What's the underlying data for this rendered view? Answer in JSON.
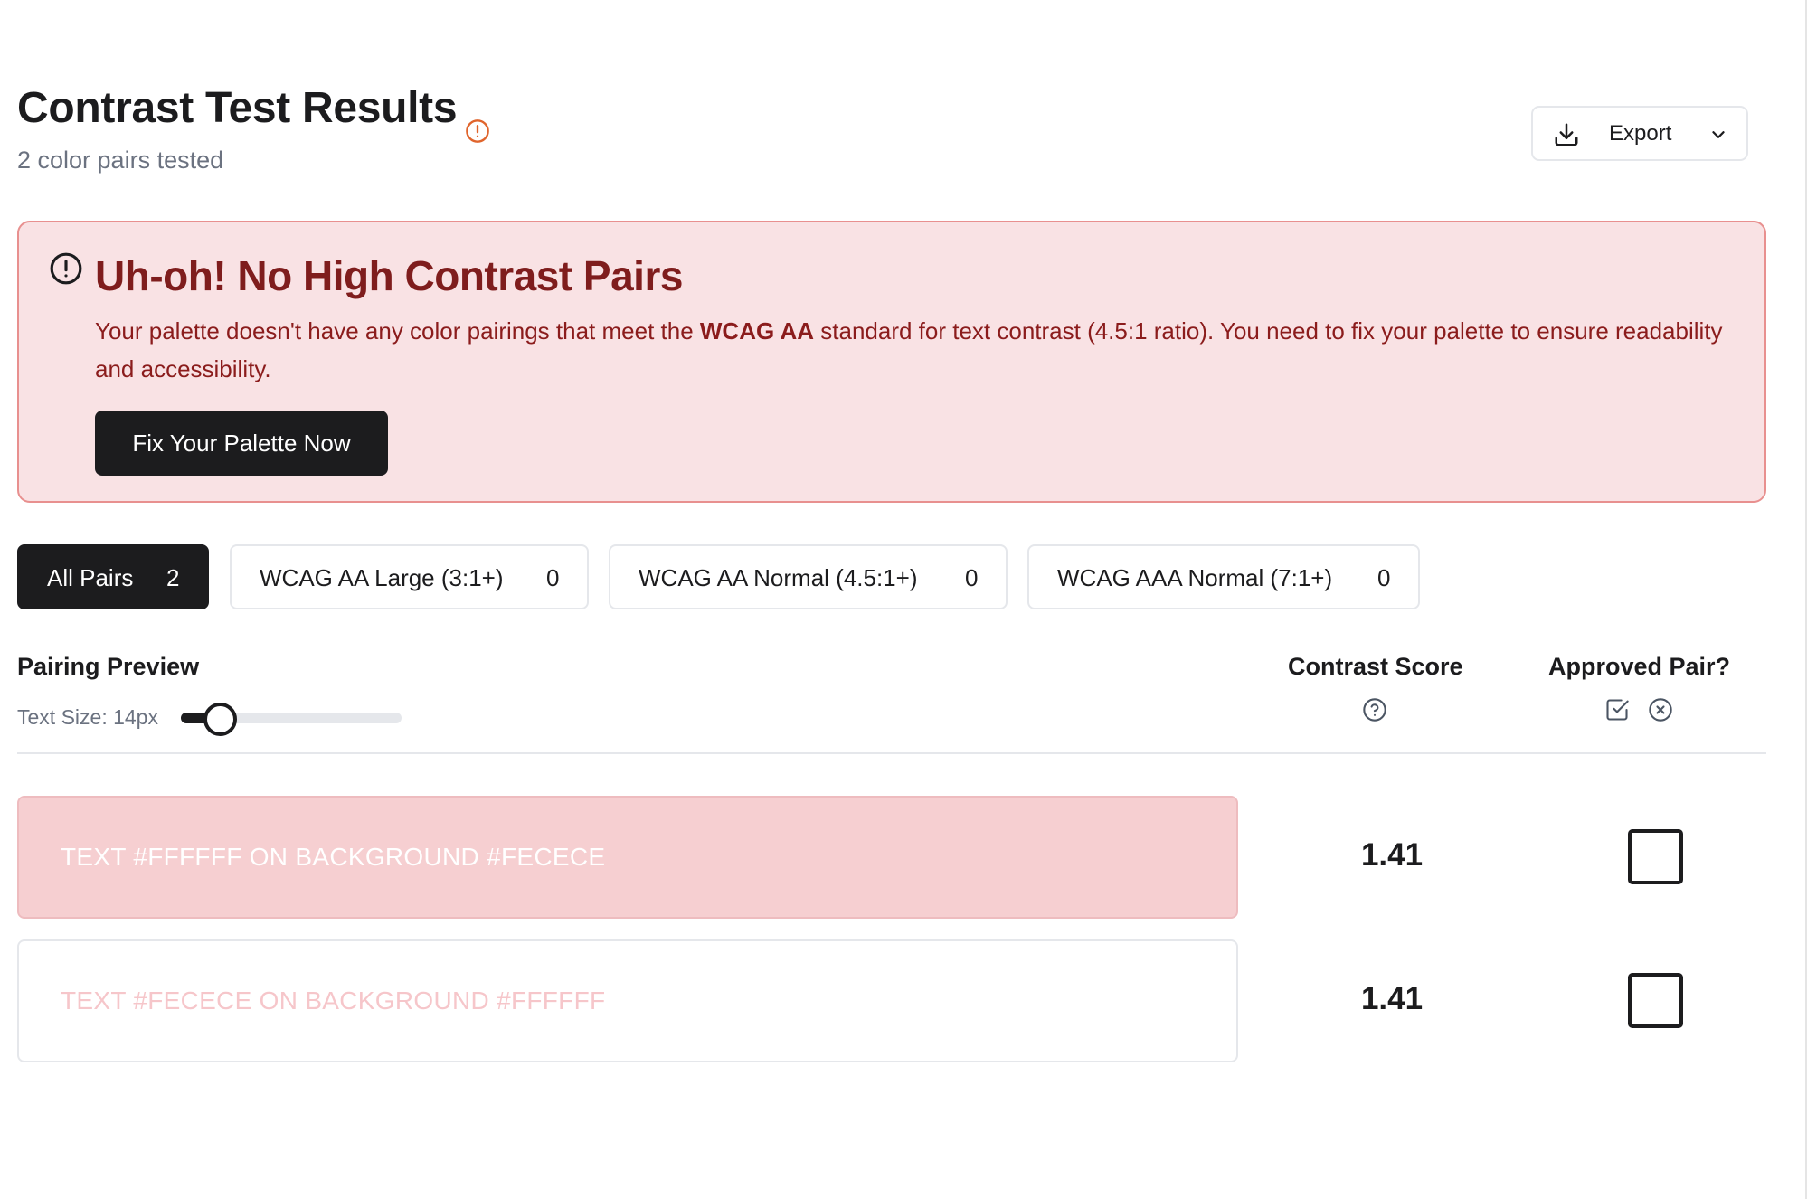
{
  "header": {
    "title": "Contrast Test Results",
    "subtitle": "2 color pairs tested",
    "export_label": "Export"
  },
  "alert": {
    "title": "Uh-oh! No High Contrast Pairs",
    "body_before": "Your palette doesn't have any color pairings that meet the ",
    "body_bold": "WCAG AA",
    "body_after": " standard for text contrast (4.5:1 ratio). You need to fix your palette to ensure readability and accessibility.",
    "button_label": "Fix Your Palette Now"
  },
  "filters": [
    {
      "label": "All Pairs",
      "count": "2",
      "active": true
    },
    {
      "label": "WCAG AA Large (3:1+)",
      "count": "0",
      "active": false
    },
    {
      "label": "WCAG AA Normal (4.5:1+)",
      "count": "0",
      "active": false
    },
    {
      "label": "WCAG AAA Normal (7:1+)",
      "count": "0",
      "active": false
    }
  ],
  "table": {
    "preview_header": "Pairing Preview",
    "text_size_label": "Text Size: 14px",
    "text_size_slider_fraction": 0.18,
    "score_header": "Contrast Score",
    "approved_header": "Approved Pair?"
  },
  "pairs": [
    {
      "text": "TEXT #FFFFFF ON BACKGROUND #FECECE",
      "text_color": "#FFFFFF",
      "background_color": "#F6CFD1",
      "score": "1.41",
      "approved": false
    },
    {
      "text": "TEXT #FECECE ON BACKGROUND #FFFFFF",
      "text_color": "#F6C6CA",
      "background_color": "#FFFFFF",
      "score": "1.41",
      "approved": false
    }
  ],
  "colors": {
    "accent_dark": "#1C1C1E",
    "alert_bg": "#F9E2E4",
    "alert_border": "#E8908F",
    "alert_text": "#8B1C1C",
    "warning_icon": "#E0652D"
  },
  "icons": {
    "title_warning": "alert-circle-icon",
    "export": "download-icon",
    "export_menu": "chevron-down-icon",
    "alert": "alert-circle-icon",
    "score_help": "help-circle-icon",
    "approve_all": "check-square-icon",
    "reject_all": "x-circle-icon"
  }
}
